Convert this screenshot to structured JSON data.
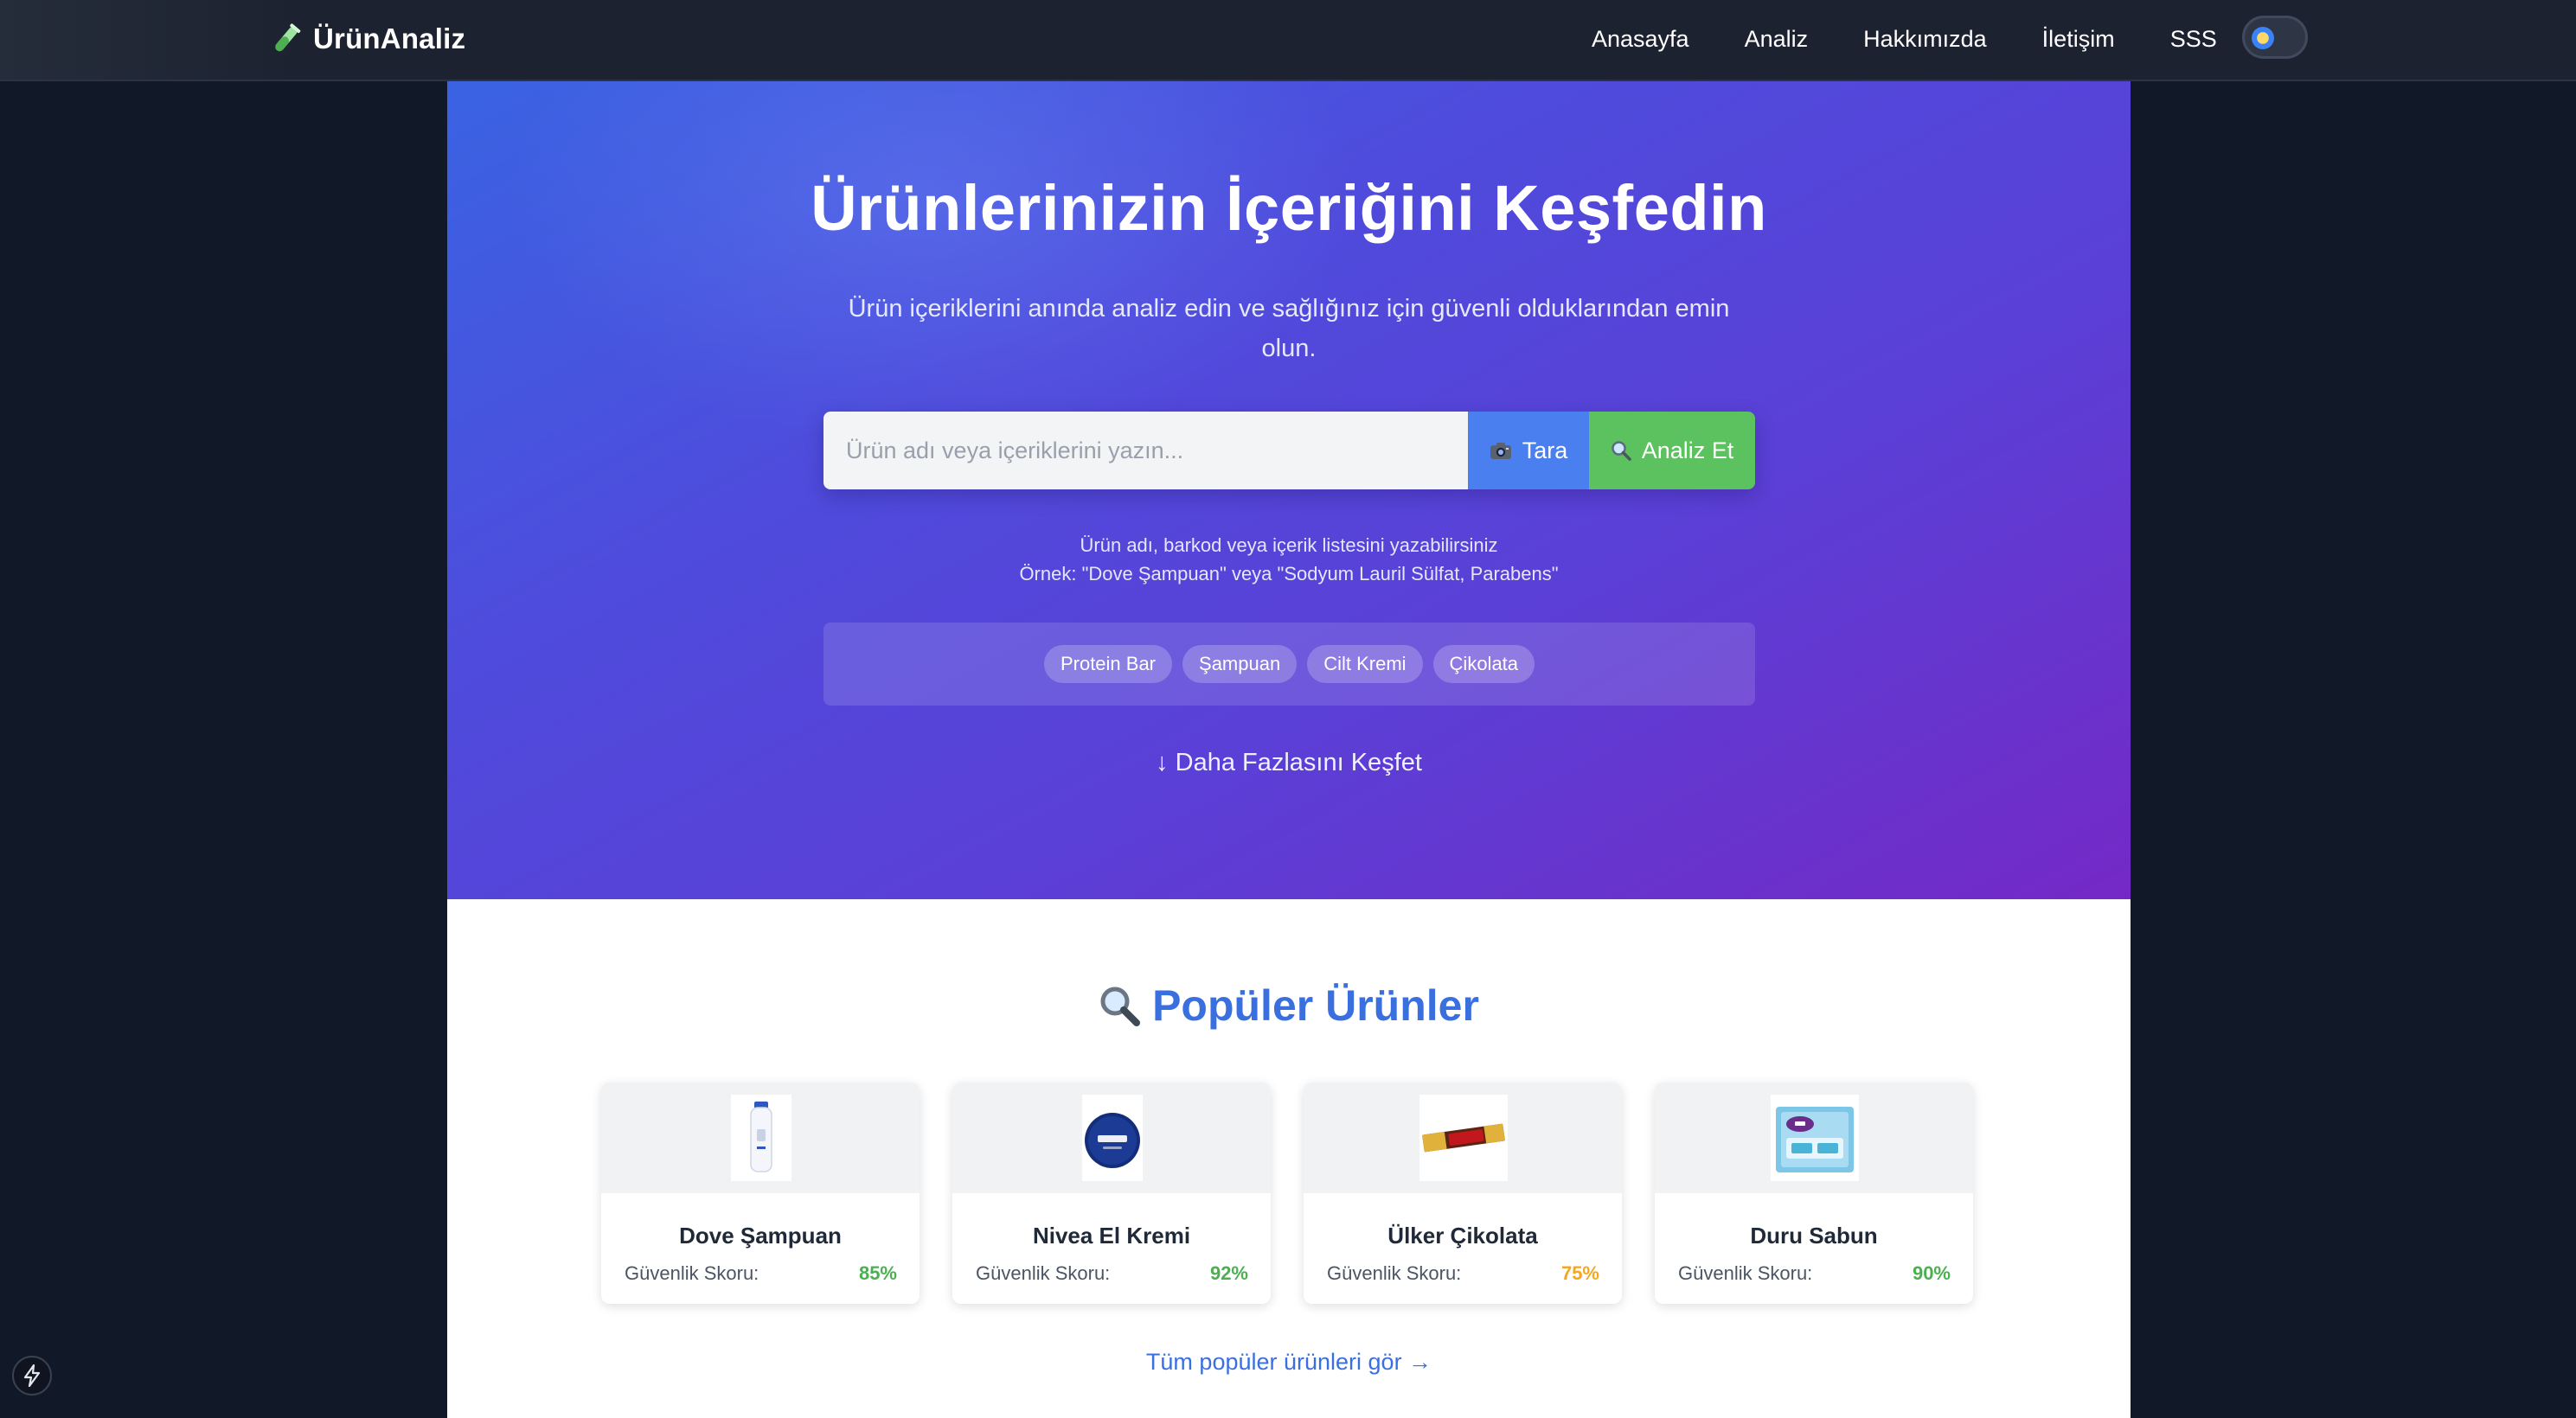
{
  "brand": {
    "name": "ÜrünAnaliz",
    "icon": "test-tube-icon",
    "color": "#5cc15f"
  },
  "nav": {
    "links": [
      "Anasayfa",
      "Analiz",
      "Hakkımızda",
      "İletişim",
      "SSS"
    ],
    "theme_toggle_icon": "sun-icon"
  },
  "hero": {
    "title": "Ürünlerinizin İçeriğini Keşfedin",
    "subtitle": "Ürün içeriklerini anında analiz edin ve sağlığınız için güvenli olduklarından emin olun.",
    "search": {
      "placeholder": "Ürün adı veya içeriklerini yazın...",
      "value": "",
      "scan_label": "Tara",
      "scan_icon": "camera-icon",
      "analyze_label": "Analiz Et",
      "analyze_icon": "magnifier-icon"
    },
    "hint_line1": "Ürün adı, barkod veya içerik listesini yazabilirsiniz",
    "hint_line2": "Örnek: \"Dove Şampuan\" veya \"Sodyum Lauril Sülfat, Parabens\"",
    "chips": [
      "Protein Bar",
      "Şampuan",
      "Cilt Kremi",
      "Çikolata"
    ],
    "explore_more": "↓ Daha Fazlasını Keşfet"
  },
  "popular": {
    "title": "Popüler Ürünler",
    "title_icon": "magnifier-icon",
    "score_label": "Güvenlik Skoru:",
    "products": [
      {
        "name": "Dove Şampuan",
        "score": "85%",
        "score_color": "#4caf50",
        "thumb": "shampoo-bottle"
      },
      {
        "name": "Nivea El Kremi",
        "score": "92%",
        "score_color": "#4caf50",
        "thumb": "cream-tin"
      },
      {
        "name": "Ülker Çikolata",
        "score": "75%",
        "score_color": "#f5a623",
        "thumb": "chocolate-bar"
      },
      {
        "name": "Duru Sabun",
        "score": "90%",
        "score_color": "#4caf50",
        "thumb": "soap-pack"
      }
    ],
    "see_all": "Tüm popüler ürünleri gör →"
  },
  "colors": {
    "page_bg": "#111827",
    "navbar_bg": "#1c2230",
    "hero_start": "#3a63e2",
    "hero_end": "#7429c6",
    "accent_blue": "#3a6fe0",
    "scan_button": "#4a7ff0",
    "analyze_button": "#5cc15f"
  }
}
